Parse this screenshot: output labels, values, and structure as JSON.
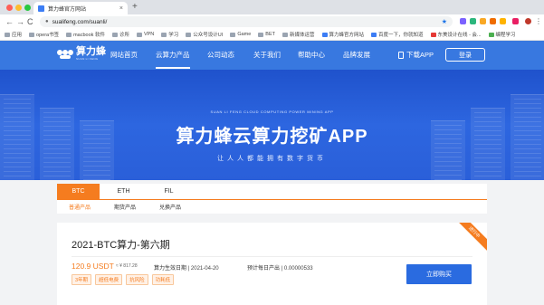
{
  "browser": {
    "tab_title": "算力蜂官方网站",
    "tab_close": "×",
    "new_tab": "+",
    "back": "←",
    "forward": "→",
    "reload": "C",
    "url": "sualifeng.com/suanli/",
    "bookmarks": [
      "应用",
      "opera书签",
      "macbook 软件",
      "诊所",
      "VPN",
      "学习",
      "公众号设计UI",
      "Game",
      "BET",
      "新媒体运营",
      "算力蜂官方网站",
      "百度一下，你就知道",
      "东美设计在线 - 会...",
      "编程学习"
    ]
  },
  "header": {
    "logo_cn": "算力蜂",
    "logo_en": "SUAN LI FENG",
    "nav": [
      "网站首页",
      "云算力产品",
      "公司动态",
      "关于我们",
      "帮助中心",
      "品牌发展"
    ],
    "active_nav": 1,
    "download_label": "下载APP",
    "login_label": "登录"
  },
  "hero": {
    "subtitle": "SUAN LI FENG CLOUD COMPUTING POWER MINING APP",
    "title": "算力蜂云算力挖矿APP",
    "slogan": "让人人都能拥有数字货币"
  },
  "tabs": {
    "coins": [
      "BTC",
      "ETH",
      "FIL"
    ],
    "active_coin": 0,
    "sub": [
      "普通产品",
      "期货产品",
      "兑换产品"
    ],
    "active_sub": 0
  },
  "product": {
    "ribbon": "进行中",
    "name": "2021-BTC算力-第六期",
    "price": "120.9 USDT",
    "price_cny": "≈ ¥ 817.28",
    "start_label": "算力生效日期",
    "start_value": "2021-04-20",
    "daily_label": "预计每日产出",
    "daily_value": "0.00000533",
    "tags": [
      "3年期",
      "超低电费",
      "抗风险",
      "功耗低"
    ],
    "buy_label": "立即购买"
  },
  "colors": {
    "brand_blue": "#3878e0",
    "accent_orange": "#f57c1f",
    "buy_blue": "#2a6be0"
  }
}
